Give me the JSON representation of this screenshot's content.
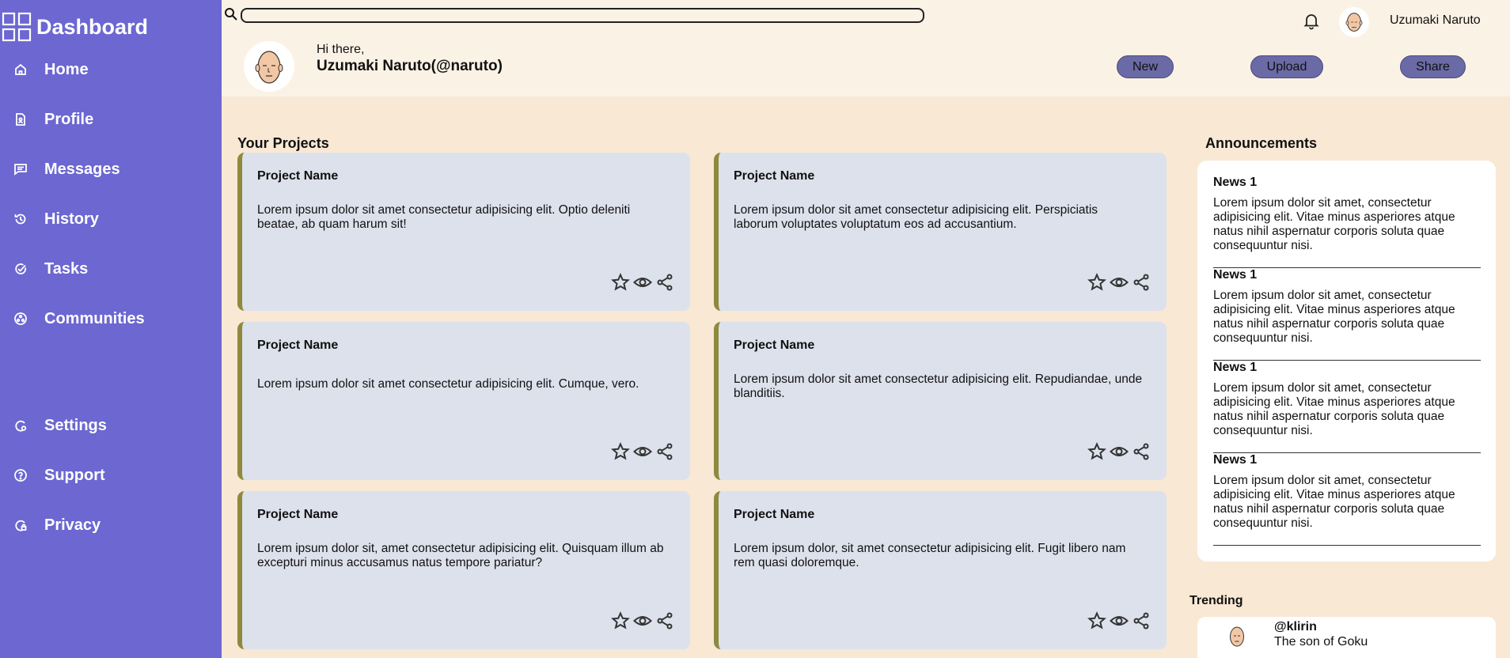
{
  "sidebar": {
    "brand": "Dashboard",
    "items": [
      {
        "label": "Home",
        "icon": "home-icon"
      },
      {
        "label": "Profile",
        "icon": "profile-icon"
      },
      {
        "label": "Messages",
        "icon": "messages-icon"
      },
      {
        "label": "History",
        "icon": "history-icon"
      },
      {
        "label": "Tasks",
        "icon": "tasks-icon"
      },
      {
        "label": "Communities",
        "icon": "communities-icon"
      },
      {
        "label": "Settings",
        "icon": "settings-icon"
      },
      {
        "label": "Support",
        "icon": "support-icon"
      },
      {
        "label": "Privacy",
        "icon": "privacy-icon"
      }
    ]
  },
  "header": {
    "search_value": "",
    "user_name": "Uzumaki Naruto",
    "greeting": "Hi there,",
    "handle": "Uzumaki Naruto(@naruto)",
    "buttons": {
      "new": "New",
      "upload": "Upload",
      "share": "Share"
    }
  },
  "projects": {
    "title": "Your Projects",
    "items": [
      {
        "name": "Project Name",
        "desc": "Lorem ipsum dolor sit amet consectetur adipisicing elit. Optio deleniti beatae, ab quam harum sit!"
      },
      {
        "name": "Project Name",
        "desc": "Lorem ipsum dolor sit amet consectetur adipisicing elit. Perspiciatis laborum voluptates voluptatum eos ad accusantium."
      },
      {
        "name": "Project Name",
        "desc": "Lorem ipsum dolor sit amet consectetur adipisicing elit. Cumque, vero."
      },
      {
        "name": "Project Name",
        "desc": "Lorem ipsum dolor sit amet consectetur adipisicing elit. Repudiandae, unde blanditiis."
      },
      {
        "name": "Project Name",
        "desc": "Lorem ipsum dolor sit, amet consectetur adipisicing elit. Quisquam illum ab excepturi minus accusamus natus tempore pariatur?"
      },
      {
        "name": "Project Name",
        "desc": "Lorem ipsum dolor, sit amet consectetur adipisicing elit. Fugit libero nam rem quasi doloremque."
      }
    ]
  },
  "announcements": {
    "title": "Announcements",
    "items": [
      {
        "title": "News 1",
        "body": "Lorem ipsum dolor sit amet, consectetur adipisicing elit. Vitae minus asperiores atque natus nihil aspernatur corporis soluta quae consequuntur nisi."
      },
      {
        "title": "News 1",
        "body": "Lorem ipsum dolor sit amet, consectetur adipisicing elit. Vitae minus asperiores atque natus nihil aspernatur corporis soluta quae consequuntur nisi."
      },
      {
        "title": "News 1",
        "body": "Lorem ipsum dolor sit amet, consectetur adipisicing elit. Vitae minus asperiores atque natus nihil aspernatur corporis soluta quae consequuntur nisi."
      },
      {
        "title": "News 1",
        "body": "Lorem ipsum dolor sit amet, consectetur adipisicing elit. Vitae minus asperiores atque natus nihil aspernatur corporis soluta quae consequuntur nisi."
      }
    ]
  },
  "trending": {
    "title": "Trending",
    "items": [
      {
        "handle": "@klirin",
        "bio": "The son of Goku"
      }
    ]
  },
  "colors": {
    "sidebar_bg": "#6c67d1",
    "page_bg": "#f8e8d4",
    "topbar_bg": "#fbf2e6",
    "card_bg": "#dde1ec",
    "card_accent": "#8e8a3d",
    "button_bg": "#6a6aa6"
  }
}
